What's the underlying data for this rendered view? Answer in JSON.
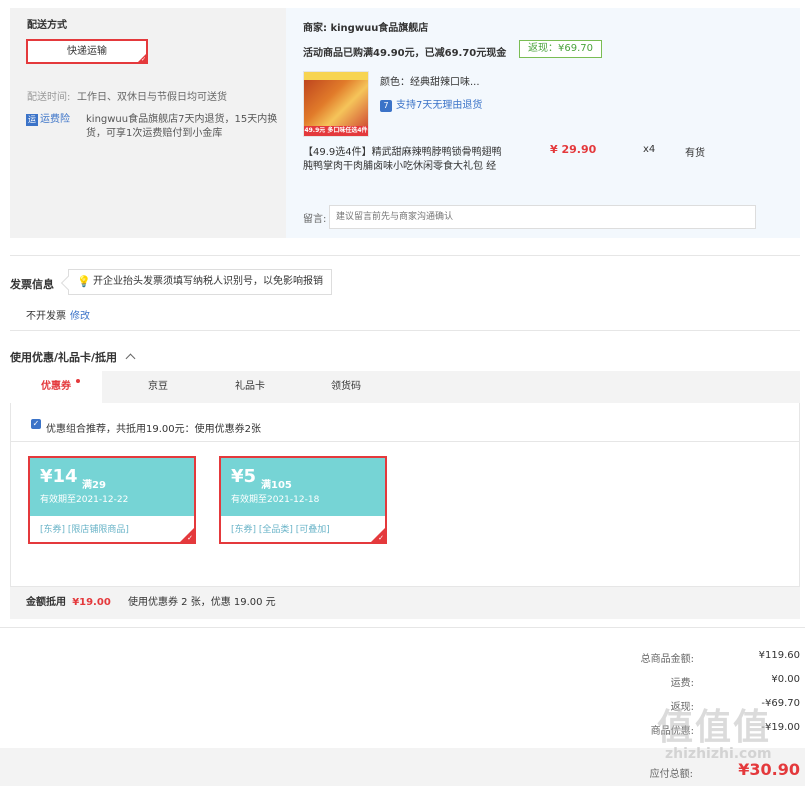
{
  "shipping": {
    "title": "配送方式",
    "method": "快递运输",
    "time_label": "配送时间:",
    "time_value": "工作日、双休日与节假日均可送货",
    "insurance_tag": "运",
    "insurance_label": "运费险",
    "insurance_desc_1": "kingwuu食品旗舰店7天内退货，15天内换",
    "insurance_desc_2": "货，可享1次运费赔付到小金库"
  },
  "store": {
    "label": "商家: kingwuu食品旗舰店",
    "promo": "活动商品已购满49.90元，已减69.70元现金",
    "fanxian": "返现：¥69.70"
  },
  "product": {
    "img_band": "49.9元 多口味任选4件",
    "color": "颜色：经典甜辣口味...",
    "return_badge": "7",
    "return_text": "支持7天无理由退货",
    "title_1": "【49.9选4件】精武甜麻辣鸭脖鸭锁骨鸭翅鸭",
    "title_2": "肫鸭掌肉干肉脯卤味小吃休闲零食大礼包 经",
    "price": "¥ 29.90",
    "qty": "x4",
    "stock": "有货"
  },
  "message": {
    "label": "留言:",
    "placeholder": "建议留言前先与商家沟通确认"
  },
  "invoice": {
    "title": "发票信息",
    "tip": "开企业抬头发票须填写纳税人识别号，以免影响报销",
    "value": "不开发票",
    "edit": "修改"
  },
  "coupons": {
    "title": "使用优惠/礼品卡/抵用",
    "tabs": [
      "优惠券",
      "京豆",
      "礼品卡",
      "领货码"
    ],
    "recommend": "优惠组合推荐，共抵用19.00元：使用优惠券2张",
    "items": [
      {
        "amount": "¥14",
        "cond": "满29",
        "expiry": "有效期至2021-12-22",
        "tags": "[东券]  [限店铺限商品]"
      },
      {
        "amount": "¥5",
        "cond": "满105",
        "expiry": "有效期至2021-12-18",
        "tags": "[东券]  [全品类]  [可叠加]"
      }
    ],
    "summary_label": "金额抵用",
    "summary_amount": "¥19.00",
    "summary_desc": "使用优惠券 2 张，优惠 19.00 元"
  },
  "totals": {
    "rows": [
      {
        "label": "总商品金额:",
        "value": "¥119.60"
      },
      {
        "label": "运费:",
        "value": "¥0.00"
      },
      {
        "label": "返现:",
        "value": "-¥69.70"
      },
      {
        "label": "商品优惠:",
        "value": "-¥19.00"
      }
    ],
    "payable_label": "应付总额:",
    "payable_value": "¥30.90"
  },
  "watermark": {
    "logo": "值值值",
    "text": "zhizhizhi.com"
  }
}
